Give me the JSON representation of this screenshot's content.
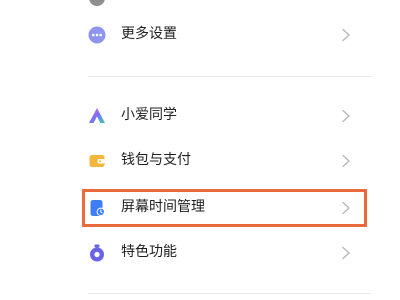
{
  "settings": {
    "items": [
      {
        "label": "更多设置",
        "icon": "more-dots-icon"
      },
      {
        "label": "小爱同学",
        "icon": "xiaoai-assistant-icon"
      },
      {
        "label": "钱包与支付",
        "icon": "wallet-icon"
      },
      {
        "label": "屏幕时间管理",
        "icon": "screen-time-icon"
      },
      {
        "label": "特色功能",
        "icon": "feature-icon"
      }
    ]
  },
  "highlight": {
    "item": "屏幕时间管理",
    "color": "#ea6a3c"
  }
}
